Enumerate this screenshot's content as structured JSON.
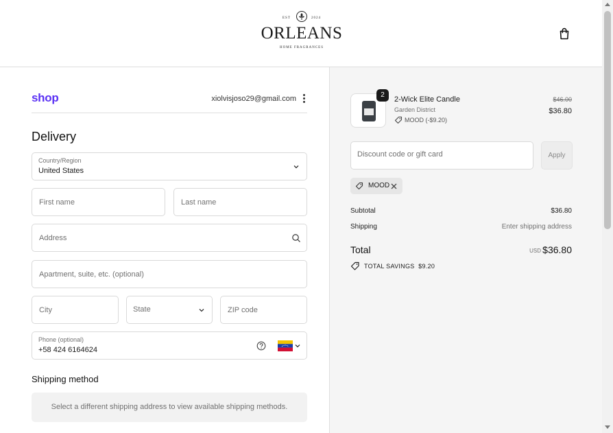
{
  "header": {
    "logo_text": "ORLEANS",
    "logo_est_left": "EST",
    "logo_est_right": "2024",
    "logo_subtitle": "HOME FRAGRANCES",
    "cart_icon": "shopping-bag-icon"
  },
  "account": {
    "shop_label": "shop",
    "email": "xiolvisjoso29@gmail.com",
    "menu_icon": "kebab-menu-icon"
  },
  "delivery": {
    "heading": "Delivery",
    "country": {
      "label": "Country/Region",
      "value": "United States"
    },
    "first_name": {
      "placeholder": "First name"
    },
    "last_name": {
      "placeholder": "Last name"
    },
    "address": {
      "placeholder": "Address"
    },
    "apartment": {
      "placeholder": "Apartment, suite, etc. (optional)"
    },
    "city": {
      "placeholder": "City"
    },
    "state": {
      "placeholder": "State"
    },
    "zip": {
      "placeholder": "ZIP code"
    },
    "phone": {
      "label": "Phone (optional)",
      "value": "+58 424 6164624",
      "flag": "venezuela-flag"
    }
  },
  "shipping_method": {
    "heading": "Shipping method",
    "message": "Select a different shipping address to view available shipping methods."
  },
  "summary": {
    "item": {
      "quantity": "2",
      "name": "2-Wick Elite Candle",
      "variant": "Garden District",
      "discount": "MOOD (-$9.20)",
      "price_original": "$46.00",
      "price": "$36.80"
    },
    "discount_field": {
      "placeholder": "Discount code or gift card",
      "button": "Apply"
    },
    "applied_code": "MOOD",
    "subtotal_label": "Subtotal",
    "subtotal_value": "$36.80",
    "shipping_label": "Shipping",
    "shipping_value": "Enter shipping address",
    "total_label": "Total",
    "currency": "USD",
    "total_value": "$36.80",
    "savings_label": "TOTAL SAVINGS",
    "savings_value": "$9.20"
  },
  "colors": {
    "shop_purple": "#5a31f4",
    "summary_bg": "#f5f5f5",
    "border": "#d9d9d9"
  }
}
